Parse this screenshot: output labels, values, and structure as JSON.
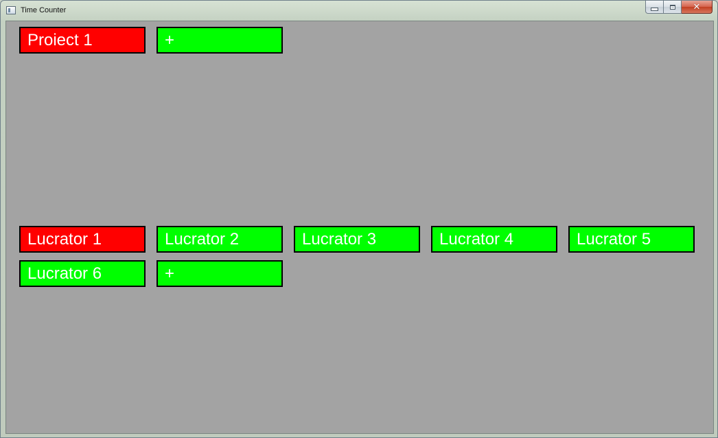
{
  "window": {
    "title": "Time Counter",
    "close_glyph": "✕"
  },
  "projects": {
    "items": [
      {
        "label": "Proiect 1",
        "color": "#ff0000"
      }
    ],
    "add_label": "+",
    "add_color": "#00ff00"
  },
  "tasks": {
    "items": [
      {
        "label": "Lucrator 1",
        "color": "#ff0000"
      },
      {
        "label": "Lucrator 2",
        "color": "#00ff00"
      },
      {
        "label": "Lucrator 3",
        "color": "#00ff00"
      },
      {
        "label": "Lucrator 4",
        "color": "#00ff00"
      },
      {
        "label": "Lucrator 5",
        "color": "#00ff00"
      },
      {
        "label": "Lucrator 6",
        "color": "#00ff00"
      }
    ],
    "add_label": "+",
    "add_color": "#00ff00"
  },
  "colors": {
    "client_background": "#a3a3a3",
    "active": "#ff0000",
    "inactive": "#00ff00",
    "tile_border": "#000000"
  }
}
